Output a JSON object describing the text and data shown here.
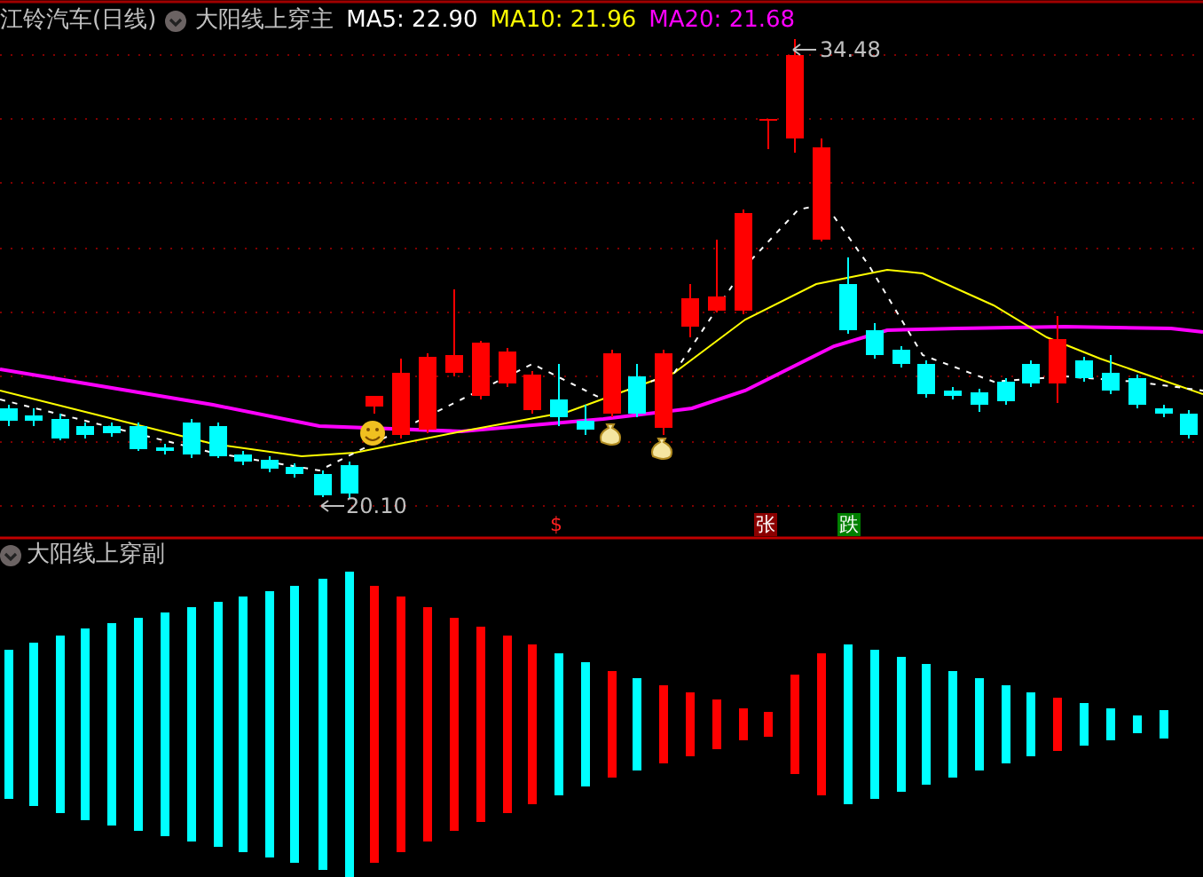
{
  "header": {
    "title": "江铃汽车(日线)",
    "indicator": "大阳线上穿主",
    "averages": [
      {
        "label": "MA5: 22.90",
        "color": "#ffffff"
      },
      {
        "label": "MA10: 21.96",
        "color": "#ffff00"
      },
      {
        "label": "MA20: 21.68",
        "color": "#ff00ff"
      }
    ]
  },
  "price_labels": {
    "high": "34.48",
    "low": "20.10"
  },
  "signals": [
    {
      "kind": "dollar",
      "text": "$"
    },
    {
      "kind": "rise",
      "text": "张"
    },
    {
      "kind": "fall",
      "text": "跌"
    }
  ],
  "sub_panel": {
    "title": "大阳线上穿副"
  }
}
